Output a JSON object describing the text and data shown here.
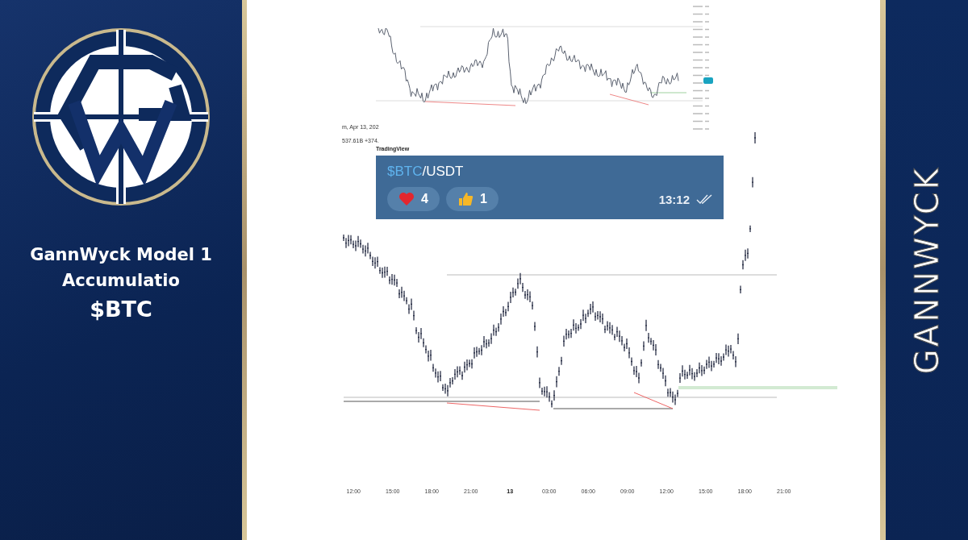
{
  "sidebar": {
    "title_lines": [
      "GannWyck Model 1",
      "Accumulatio"
    ],
    "ticker": "$BTC"
  },
  "chart_header": {
    "date": "m, Apr 13, 202",
    "volume": "537.61B +374.",
    "source": "TradingView"
  },
  "message": {
    "ticker_link": "$BTC",
    "pair_rest": "/USDT",
    "time": "13:12",
    "read": true,
    "reactions": [
      {
        "kind": "heart",
        "count": "4"
      },
      {
        "kind": "thumbs-up",
        "count": "1"
      }
    ]
  },
  "time_axis": [
    {
      "label": "12:00",
      "bold": false
    },
    {
      "label": "15:00",
      "bold": false
    },
    {
      "label": "18:00",
      "bold": false
    },
    {
      "label": "21:00",
      "bold": false
    },
    {
      "label": "13",
      "bold": true
    },
    {
      "label": "03:00",
      "bold": false
    },
    {
      "label": "06:00",
      "bold": false
    },
    {
      "label": "09:00",
      "bold": false
    },
    {
      "label": "12:00",
      "bold": false
    },
    {
      "label": "15:00",
      "bold": false
    },
    {
      "label": "18:00",
      "bold": false
    },
    {
      "label": "21:00",
      "bold": false
    }
  ],
  "side_banner": {
    "text": "GANNWYCK"
  }
}
